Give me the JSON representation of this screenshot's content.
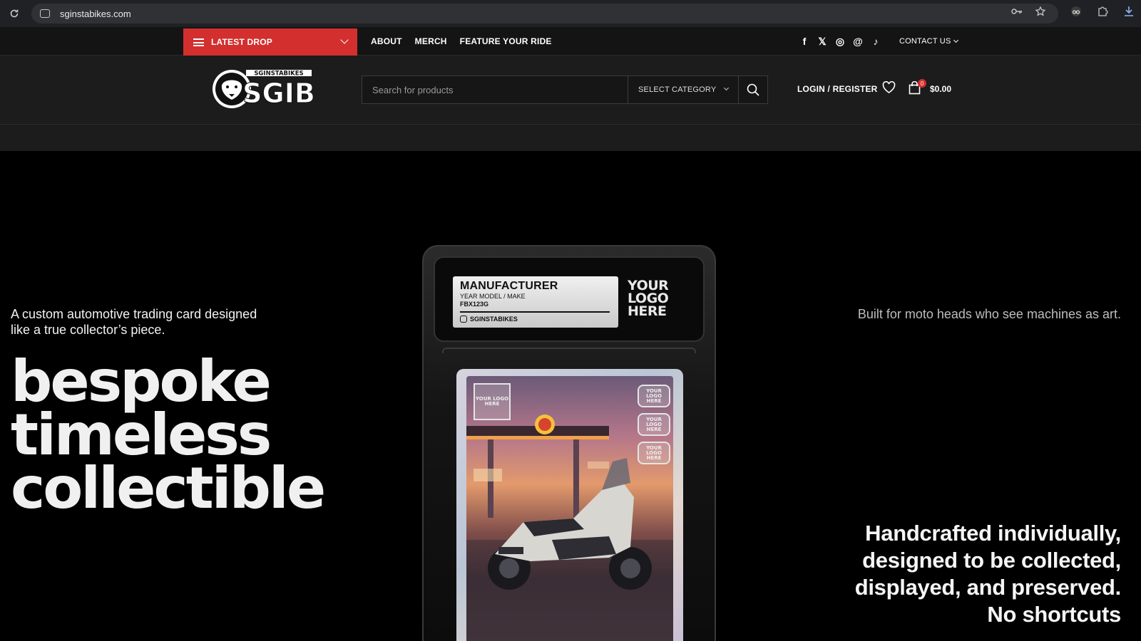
{
  "browser": {
    "url": "sginstabikes.com"
  },
  "topnav": {
    "latest_drop": "LATEST DROP",
    "links": [
      "ABOUT",
      "MERCH",
      "FEATURE YOUR RIDE"
    ],
    "socials": {
      "facebook": "f",
      "x": "𝕏",
      "instagram": "◎",
      "threads": "@",
      "tiktok": "♪"
    },
    "contact": "CONTACT US"
  },
  "header": {
    "brand_small": "SGINSTABIKES",
    "brand_big": "SGIB",
    "search_placeholder": "Search for products",
    "category": "SELECT CATEGORY",
    "login": "LOGIN / REGISTER",
    "cart_count": "0",
    "cart_total": "$0.00"
  },
  "hero": {
    "tagline_left": "A custom automotive trading card designed like a true collector’s piece.",
    "big_words": [
      "bespoke",
      "timeless",
      "collectible"
    ],
    "tagline_right": "Built for moto heads who see machines as art.",
    "bottom_right": "Handcrafted individually, designed to be collected, displayed, and preserved. No shortcuts"
  },
  "slab": {
    "manufacturer": "MANUFACTURER",
    "year_model": "YEAR MODEL / MAKE",
    "code": "FBX123G",
    "handle": "SGINSTABIKES",
    "logo_here": "YOUR LOGO HERE",
    "card_badge": "YOUR LOGO HERE"
  },
  "colors": {
    "accent": "#d32f2f",
    "background": "#000000",
    "header_bg": "#1c1c1c"
  }
}
